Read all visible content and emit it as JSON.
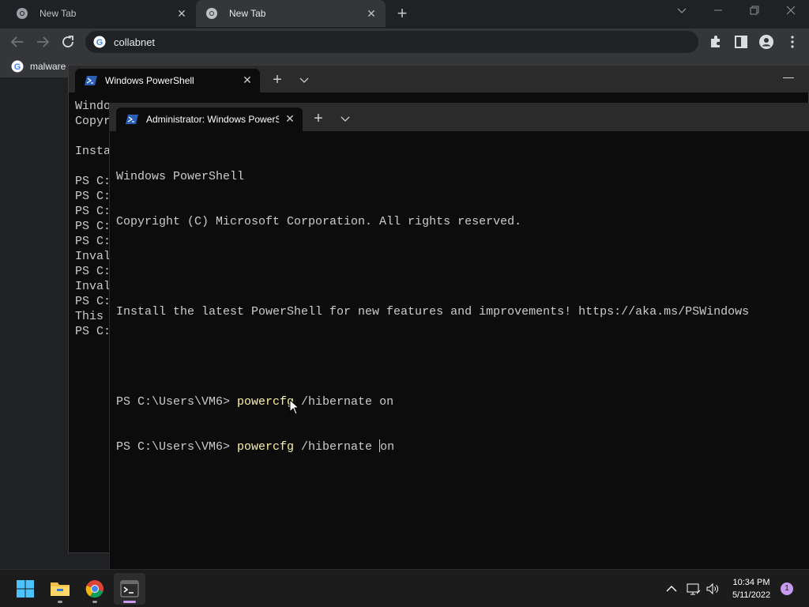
{
  "browser": {
    "tabs": [
      {
        "title": "New Tab",
        "active": false
      },
      {
        "title": "New Tab",
        "active": true
      }
    ],
    "address": "collabnet",
    "bookmarks": [
      {
        "label": "malware"
      }
    ]
  },
  "terminal_back": {
    "tab_title": "Windows PowerShell",
    "lines": [
      "Windo",
      "Copyr",
      "",
      "Insta",
      "",
      "PS C:",
      "PS C:",
      "PS C:",
      "PS C:",
      "PS C:",
      "Inval",
      "PS C:",
      "Inval",
      "PS C:",
      "This ",
      "PS C:"
    ]
  },
  "terminal_front": {
    "tab_title": "Administrator: Windows PowerS",
    "header_lines": [
      "Windows PowerShell",
      "Copyright (C) Microsoft Corporation. All rights reserved.",
      "",
      "Install the latest PowerShell for new features and improvements! https://aka.ms/PSWindows",
      ""
    ],
    "prompt_lines": [
      {
        "prompt": "PS C:\\Users\\VM6> ",
        "command": "powercfg",
        "args": " /hibernate on"
      },
      {
        "prompt": "PS C:\\Users\\VM6> ",
        "command": "powercfg",
        "args_before_cursor": " /hibernate ",
        "args_after_cursor": "on"
      }
    ]
  },
  "taskbar": {
    "apps": [
      {
        "name": "Start",
        "icon": "windows-logo-icon"
      },
      {
        "name": "File Explorer",
        "icon": "folder-icon"
      },
      {
        "name": "Google Chrome",
        "icon": "chrome-icon"
      },
      {
        "name": "Windows Terminal",
        "icon": "terminal-icon",
        "active": true
      }
    ],
    "time": "10:34 PM",
    "date": "5/11/2022",
    "notification_count": "1"
  },
  "colors": {
    "terminal_bg": "#0c0c0c",
    "terminal_text": "#cccccc",
    "command_yellow": "#f9f1a5",
    "accent": "#c89af0"
  }
}
